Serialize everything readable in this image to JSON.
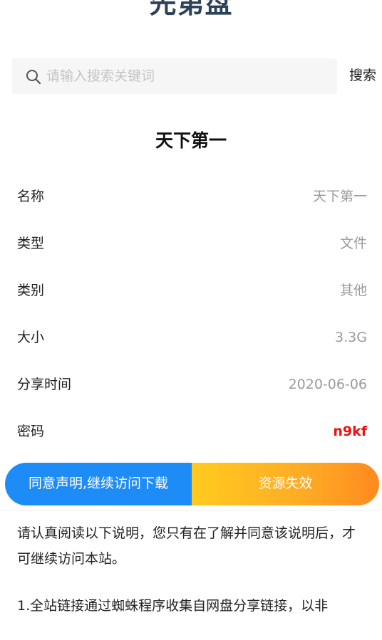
{
  "site": {
    "logo_text": "先第盘"
  },
  "search": {
    "placeholder": "请输入搜索关键词",
    "value": "",
    "button_label": "搜索"
  },
  "resource": {
    "title": "天下第一",
    "fields": [
      {
        "label": "名称",
        "value": "天下第一"
      },
      {
        "label": "类型",
        "value": "文件"
      },
      {
        "label": "类别",
        "value": "其他"
      },
      {
        "label": "大小",
        "value": "3.3G"
      },
      {
        "label": "分享时间",
        "value": "2020-06-06"
      },
      {
        "label": "密码",
        "value": "n9kf"
      }
    ]
  },
  "actions": {
    "download_label": "同意声明,继续访问下载",
    "invalid_label": "资源失效"
  },
  "notice": {
    "paragraphs": [
      "请认真阅读以下说明，您只有在了解并同意该说明后，才可继续访问本站。",
      "1.全站链接通过蜘蛛程序收集自网盘分享链接，以非"
    ]
  },
  "colors": {
    "logo": "#2d4258",
    "primary_button": "#1e8cf7",
    "secondary_button_gradient": [
      "#ffcb1f",
      "#ff8a1e"
    ],
    "password": "#ee1111",
    "value_text": "#9a9a9a"
  }
}
